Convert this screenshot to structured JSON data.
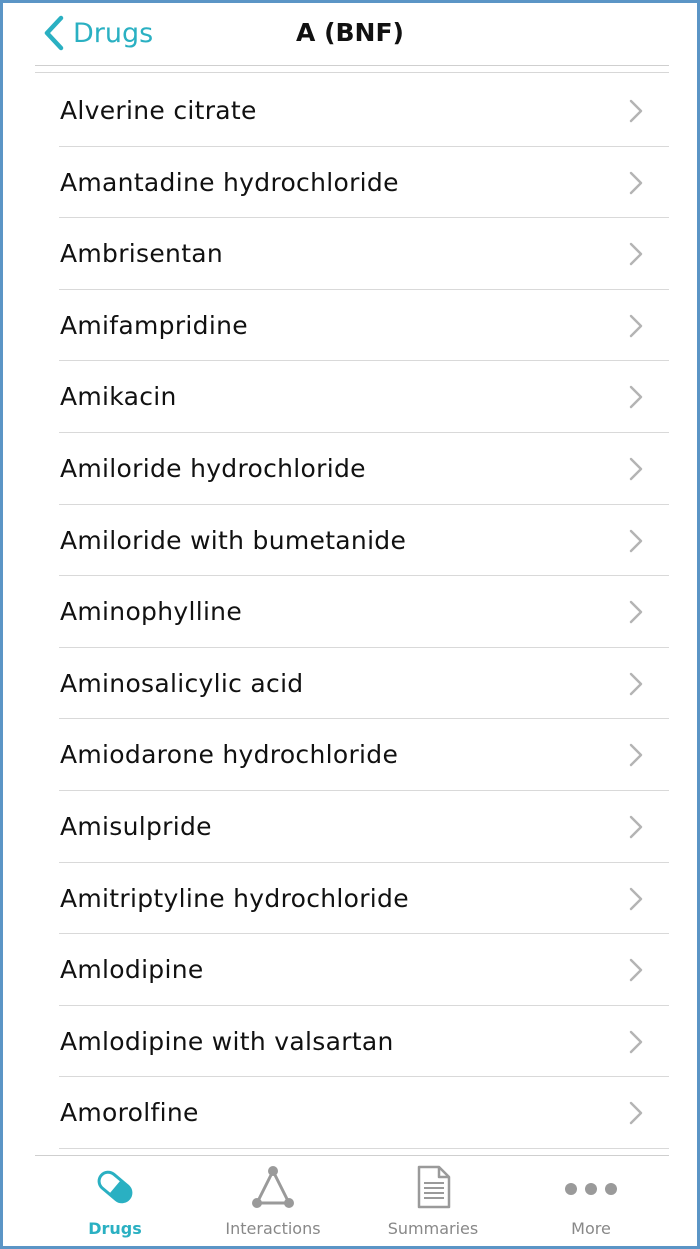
{
  "nav": {
    "back_label": "Drugs",
    "title": "A (BNF)"
  },
  "drugs": [
    "Alverine citrate",
    "Amantadine hydrochloride",
    "Ambrisentan",
    "Amifampridine",
    "Amikacin",
    "Amiloride hydrochloride",
    "Amiloride with bumetanide",
    "Aminophylline",
    "Aminosalicylic acid",
    "Amiodarone hydrochloride",
    "Amisulpride",
    "Amitriptyline hydrochloride",
    "Amlodipine",
    "Amlodipine with valsartan",
    "Amorolfine"
  ],
  "tabs": [
    {
      "label": "Drugs",
      "icon": "capsule-icon",
      "active": true
    },
    {
      "label": "Interactions",
      "icon": "triangle-nodes-icon",
      "active": false
    },
    {
      "label": "Summaries",
      "icon": "document-icon",
      "active": false
    },
    {
      "label": "More",
      "icon": "ellipsis-icon",
      "active": false
    }
  ],
  "colors": {
    "accent": "#2ab0c2",
    "inactive": "#888888",
    "text": "#111111",
    "separator": "#d9d9d9"
  }
}
